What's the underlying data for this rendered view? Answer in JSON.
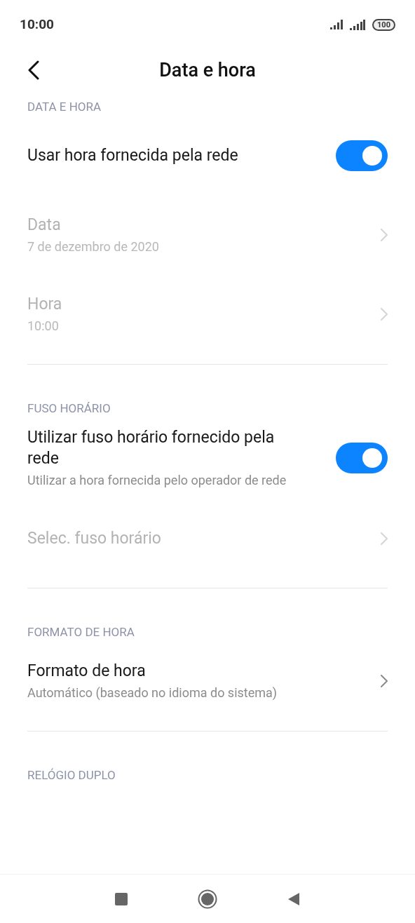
{
  "status_bar": {
    "time": "10:00",
    "battery": "100"
  },
  "header": {
    "title": "Data e hora"
  },
  "sections": [
    {
      "title": "DATA E HORA",
      "items": [
        {
          "kind": "toggle",
          "title": "Usar hora fornecida pela rede",
          "on": true,
          "disabled": false
        },
        {
          "kind": "link",
          "title": "Data",
          "subtitle": "7 de dezembro de 2020",
          "disabled": true
        },
        {
          "kind": "link",
          "title": "Hora",
          "subtitle": "10:00",
          "disabled": true
        }
      ]
    },
    {
      "title": "FUSO HORÁRIO",
      "items": [
        {
          "kind": "toggle",
          "title": "Utilizar fuso horário fornecido pela rede",
          "subtitle": "Utilizar a hora fornecida pelo operador de rede",
          "on": true,
          "disabled": false
        },
        {
          "kind": "link",
          "title": "Selec. fuso horário",
          "disabled": true
        }
      ]
    },
    {
      "title": "FORMATO DE HORA",
      "items": [
        {
          "kind": "link",
          "title": "Formato de hora",
          "subtitle": "Automático (baseado no idioma do sistema)",
          "disabled": false
        }
      ]
    },
    {
      "title": "RELÓGIO DUPLO"
    }
  ]
}
